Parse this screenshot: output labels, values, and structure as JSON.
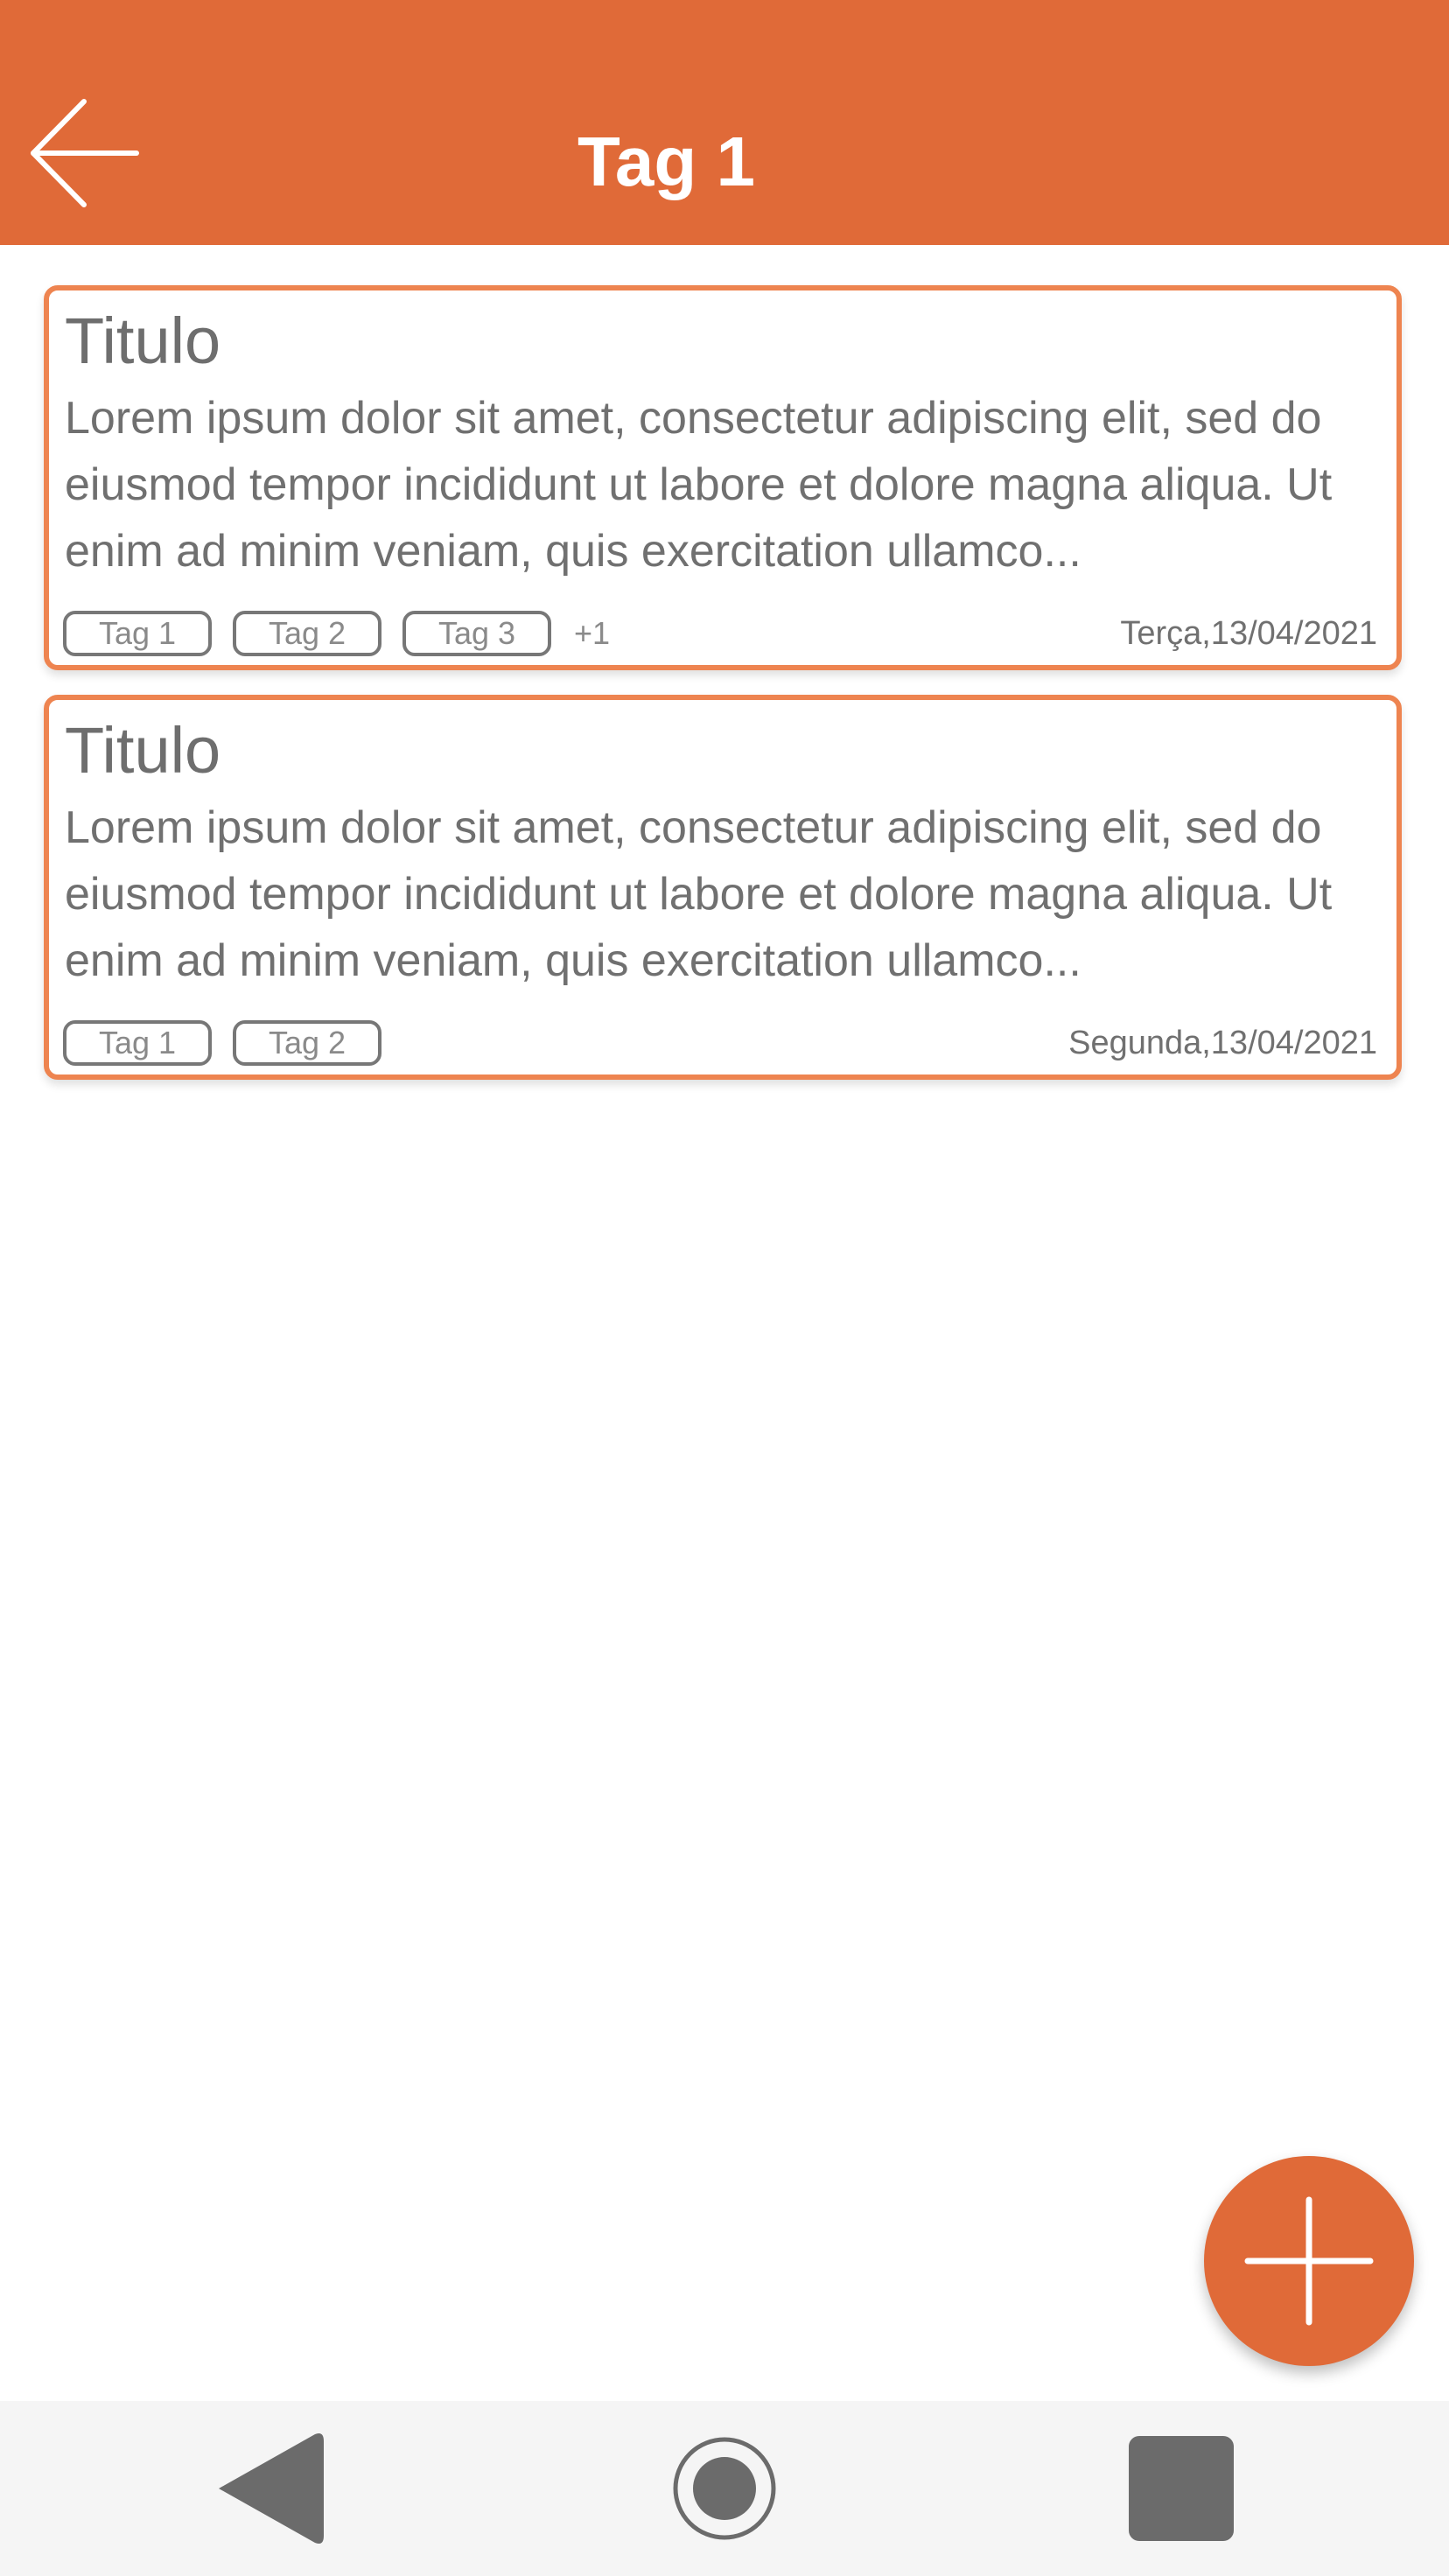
{
  "header": {
    "title": "Tag 1",
    "back_icon": "arrow-left-icon",
    "color": "#E06A38"
  },
  "notes": [
    {
      "title": "Titulo",
      "body": "Lorem ipsum dolor sit amet, consectetur adipiscing elit, sed do eiusmod tempor incididunt ut labore et dolore magna aliqua. Ut enim ad minim veniam, quis exercitation ullamco...",
      "tags": [
        "Tag 1",
        "Tag 2",
        "Tag 3"
      ],
      "more_tags": "+1",
      "date": "Terça,13/04/2021"
    },
    {
      "title": "Titulo",
      "body": "Lorem ipsum dolor sit amet, consectetur adipiscing elit, sed do eiusmod tempor incididunt ut labore et dolore magna aliqua. Ut enim ad minim veniam, quis exercitation ullamco...",
      "tags": [
        "Tag 1",
        "Tag 2"
      ],
      "date": "Segunda,13/04/2021"
    }
  ],
  "fab": {
    "icon": "plus-icon",
    "color": "#E06A38"
  },
  "system_nav": {
    "back_icon": "triangle-back-icon",
    "home_icon": "circle-home-icon",
    "recent_icon": "square-recent-icon"
  },
  "colors": {
    "accent": "#E06A38",
    "card_border": "#EE8450",
    "text": "#707070"
  }
}
